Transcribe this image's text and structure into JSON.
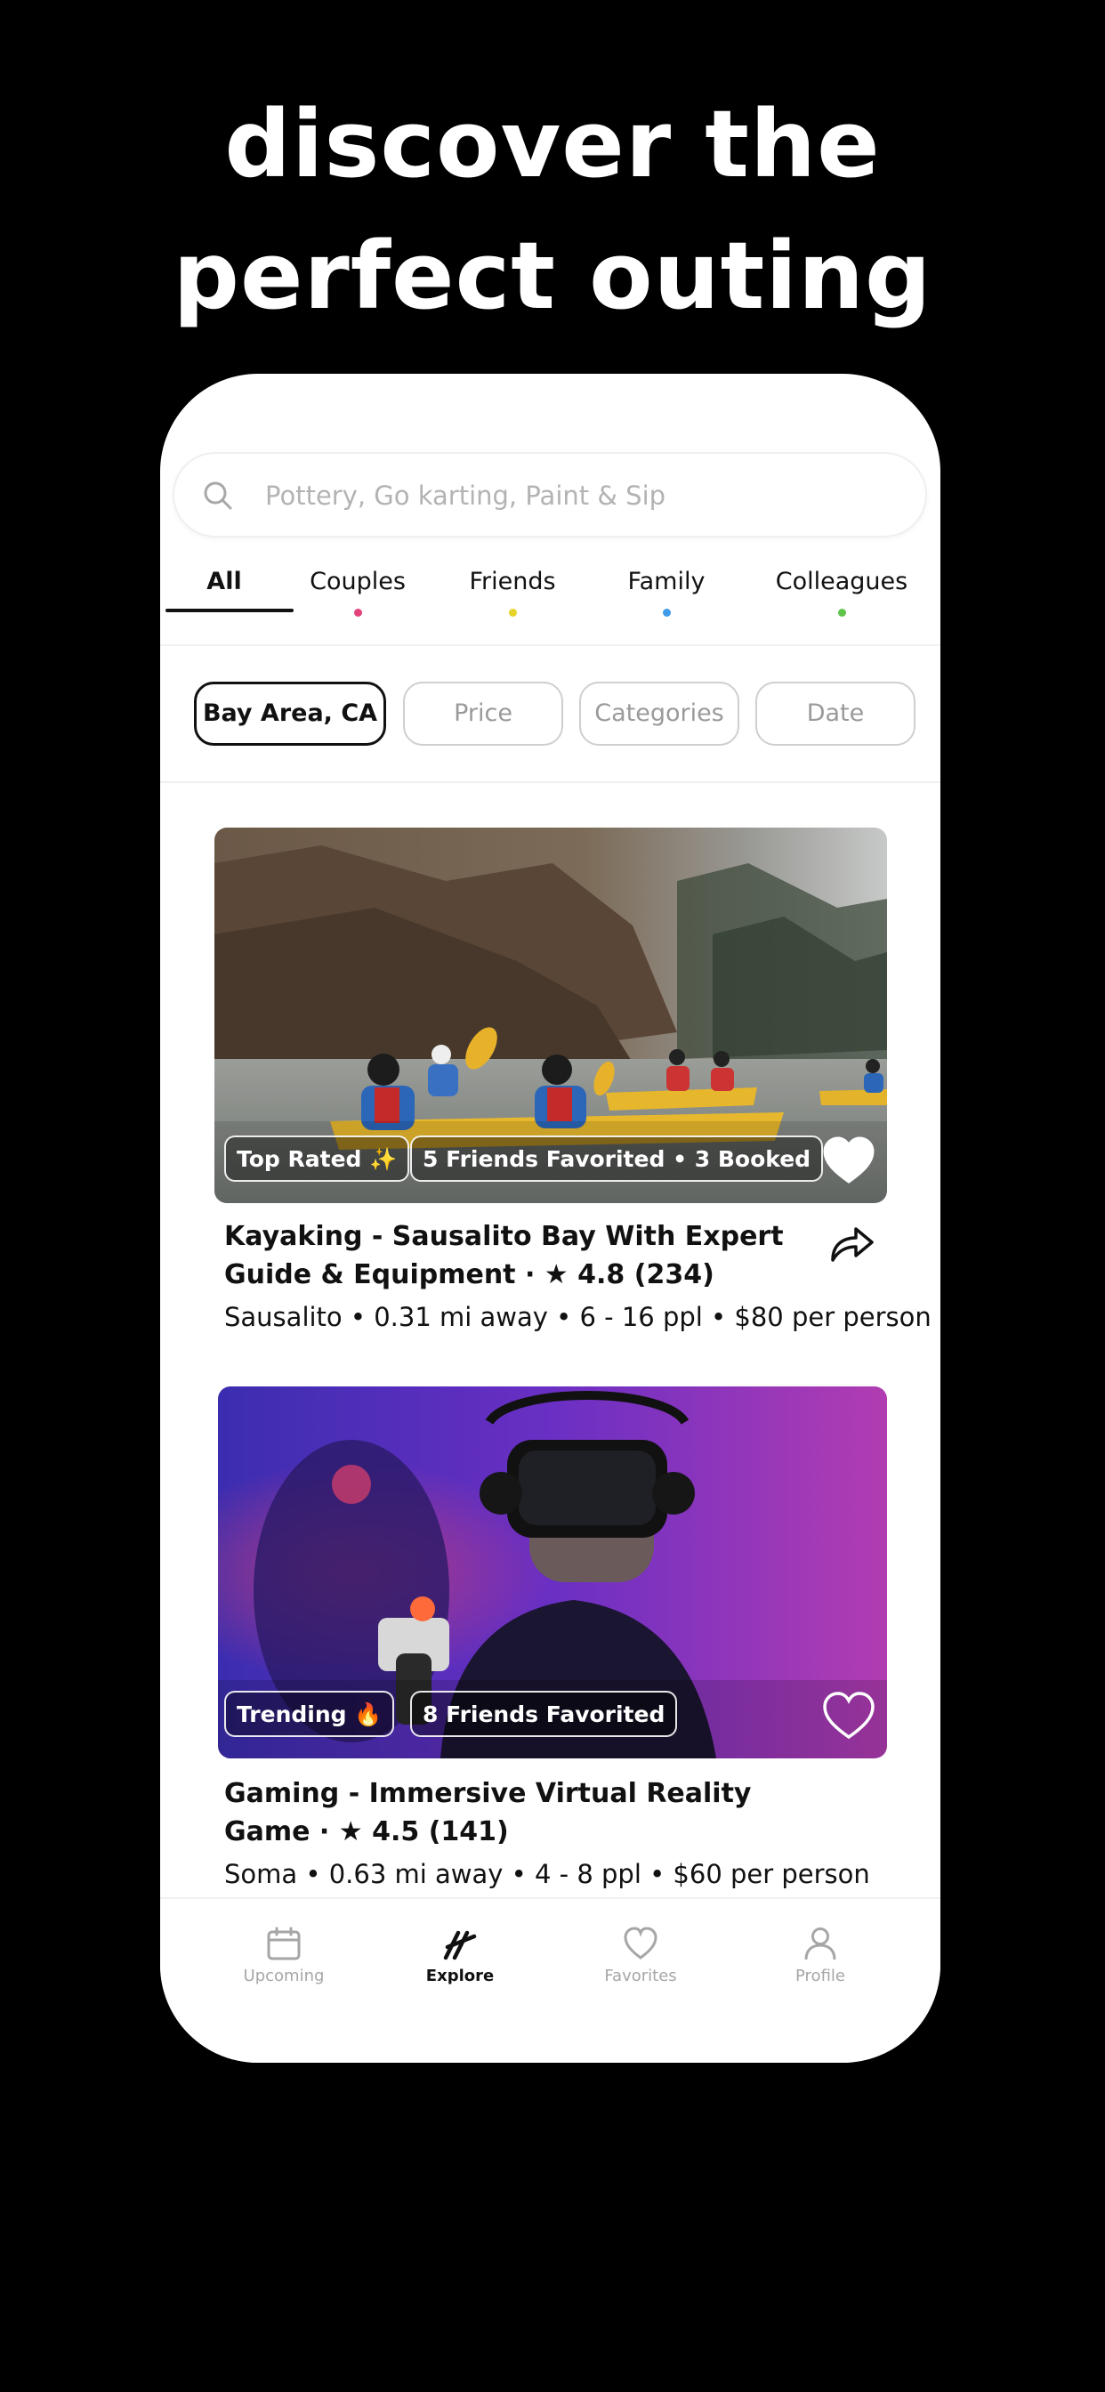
{
  "headline": {
    "line1": "discover the",
    "line2": "perfect outing"
  },
  "search": {
    "placeholder": "Pottery, Go karting, Paint & Sip"
  },
  "tabs": [
    {
      "label": "All",
      "active": true
    },
    {
      "label": "Couples",
      "dot_color": "#e5427b"
    },
    {
      "label": "Friends",
      "dot_color": "#e6d32a"
    },
    {
      "label": "Family",
      "dot_color": "#3d9bea"
    },
    {
      "label": "Colleagues",
      "dot_color": "#5fc44a"
    }
  ],
  "filters": [
    {
      "label": "Bay Area, CA",
      "active": true
    },
    {
      "label": "Price"
    },
    {
      "label": "Categories"
    },
    {
      "label": "Date"
    }
  ],
  "listings": [
    {
      "badges": [
        "Top Rated ✨",
        "5 Friends Favorited • 3 Booked"
      ],
      "favorited": true,
      "title": "Kayaking - Sausalito Bay With Expert Guide & Equipment · ★ 4.8 (234)",
      "meta": "Sausalito • 0.31 mi away • 6 - 16 ppl • $80 per person",
      "image": "kayakers-in-bay-photo"
    },
    {
      "badges": [
        "Trending 🔥",
        "8 Friends Favorited"
      ],
      "favorited": false,
      "title": "Gaming - Immersive Virtual Reality Game · ★ 4.5 (141)",
      "meta": "Soma • 0.63 mi away • 4 - 8 ppl • $60 per person",
      "image": "vr-gamer-photo"
    }
  ],
  "bottom_nav": [
    {
      "label": "Upcoming",
      "icon": "calendar-icon"
    },
    {
      "label": "Explore",
      "icon": "explore-slashes-icon",
      "active": true
    },
    {
      "label": "Favorites",
      "icon": "heart-icon"
    },
    {
      "label": "Profile",
      "icon": "person-icon"
    }
  ],
  "colors": {
    "background": "#000000",
    "card": "#ffffff",
    "text": "#111111",
    "muted": "#a6a6a6"
  }
}
